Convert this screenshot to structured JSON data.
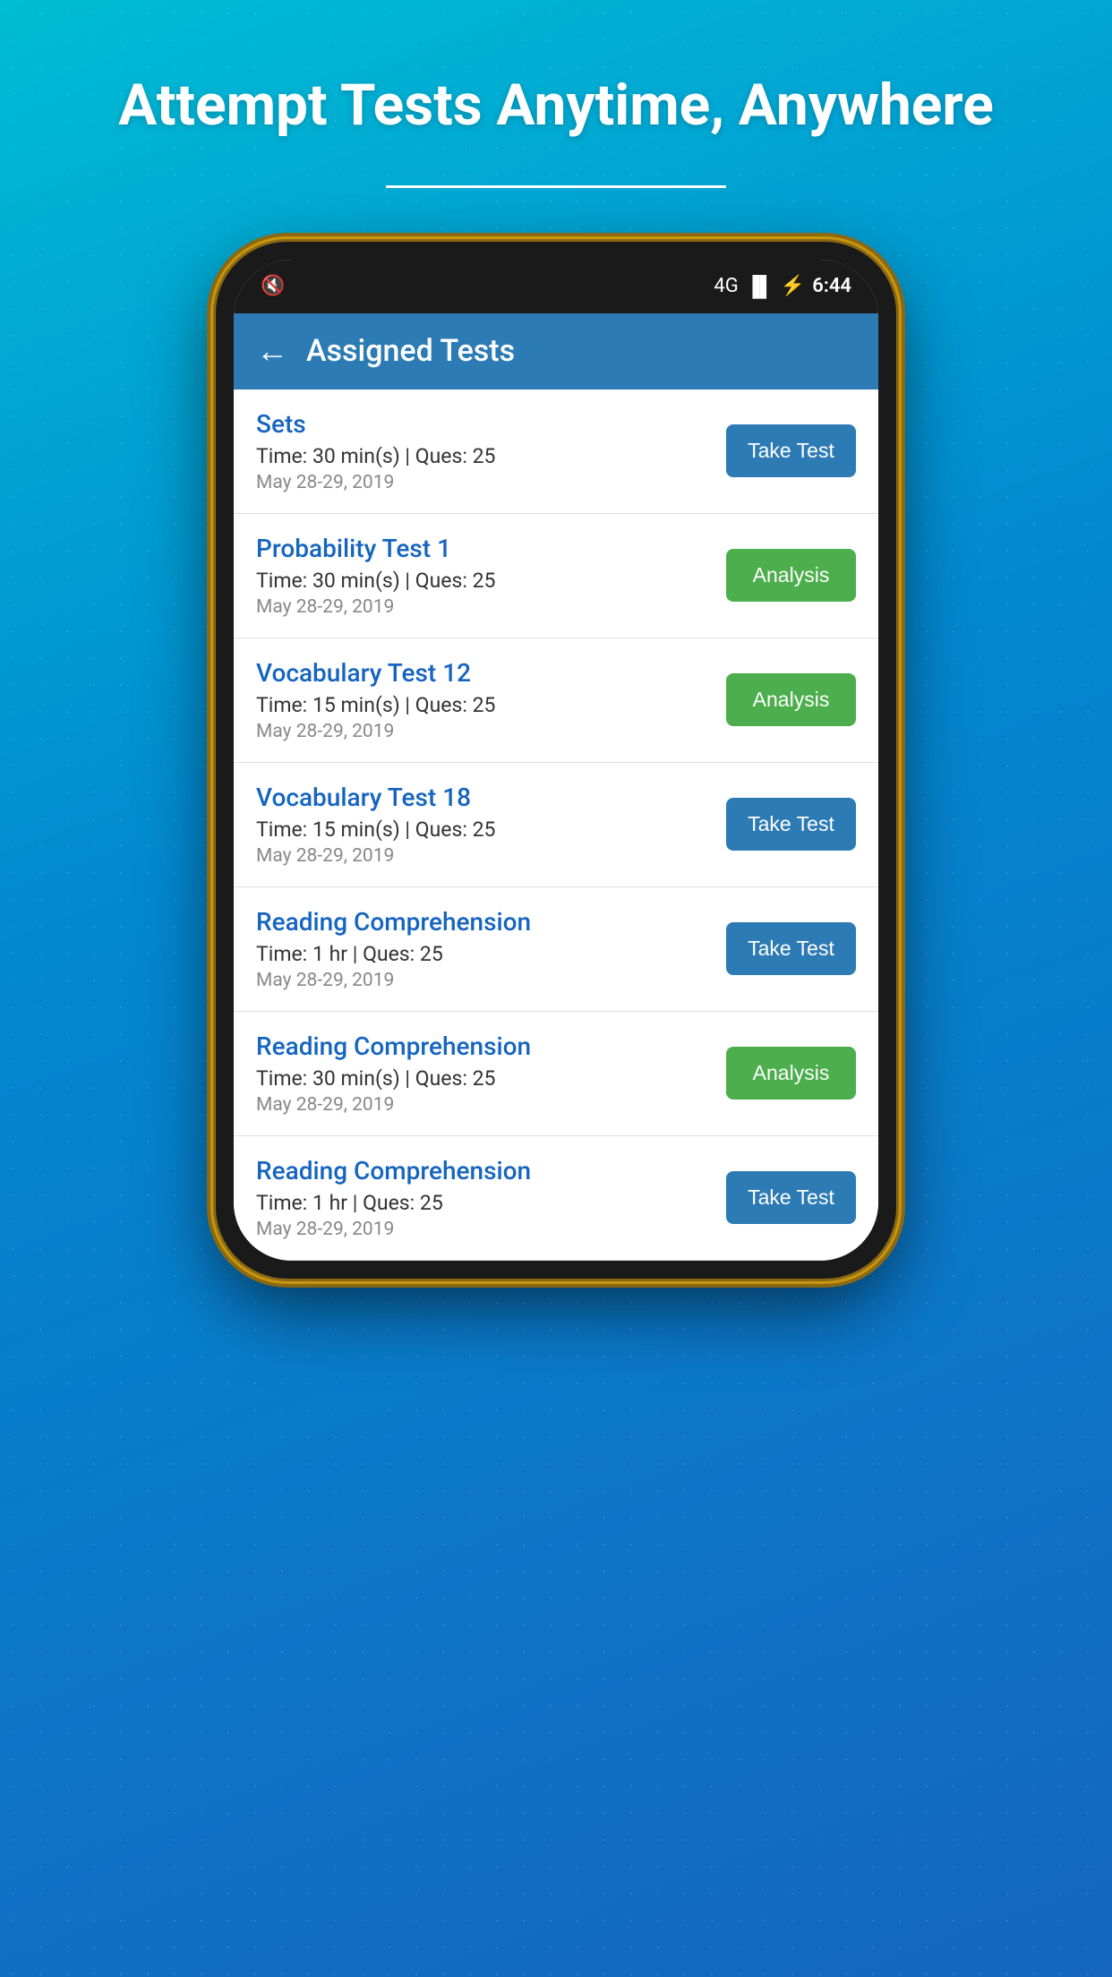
{
  "hero": {
    "title": "Attempt Tests Anytime, Anywhere"
  },
  "statusBar": {
    "time": "6:44",
    "network": "4G",
    "battery_icon": "⚡",
    "signal_icon": "📶"
  },
  "header": {
    "title": "Assigned Tests",
    "back_label": "←"
  },
  "tests": [
    {
      "name": "Sets",
      "time": "Time: 30 min(s) | Ques: 25",
      "date": "May 28-29, 2019",
      "button_label": "Take Test",
      "button_type": "take"
    },
    {
      "name": "Probability Test 1",
      "time": "Time: 30 min(s) | Ques: 25",
      "date": "May 28-29, 2019",
      "button_label": "Analysis",
      "button_type": "analysis"
    },
    {
      "name": "Vocabulary Test 12",
      "time": "Time: 15 min(s) | Ques: 25",
      "date": "May 28-29, 2019",
      "button_label": "Analysis",
      "button_type": "analysis"
    },
    {
      "name": "Vocabulary Test 18",
      "time": "Time: 15 min(s) | Ques: 25",
      "date": "May 28-29, 2019",
      "button_label": "Take Test",
      "button_type": "take"
    },
    {
      "name": "Reading Comprehension",
      "time": "Time: 1 hr | Ques: 25",
      "date": "May 28-29, 2019",
      "button_label": "Take Test",
      "button_type": "take"
    },
    {
      "name": "Reading Comprehension",
      "time": "Time: 30 min(s) | Ques: 25",
      "date": "May 28-29, 2019",
      "button_label": "Analysis",
      "button_type": "analysis"
    },
    {
      "name": "Reading Comprehension",
      "time": "Time: 1 hr | Ques: 25",
      "date": "May 28-29, 2019",
      "button_label": "Take Test",
      "button_type": "take"
    }
  ]
}
